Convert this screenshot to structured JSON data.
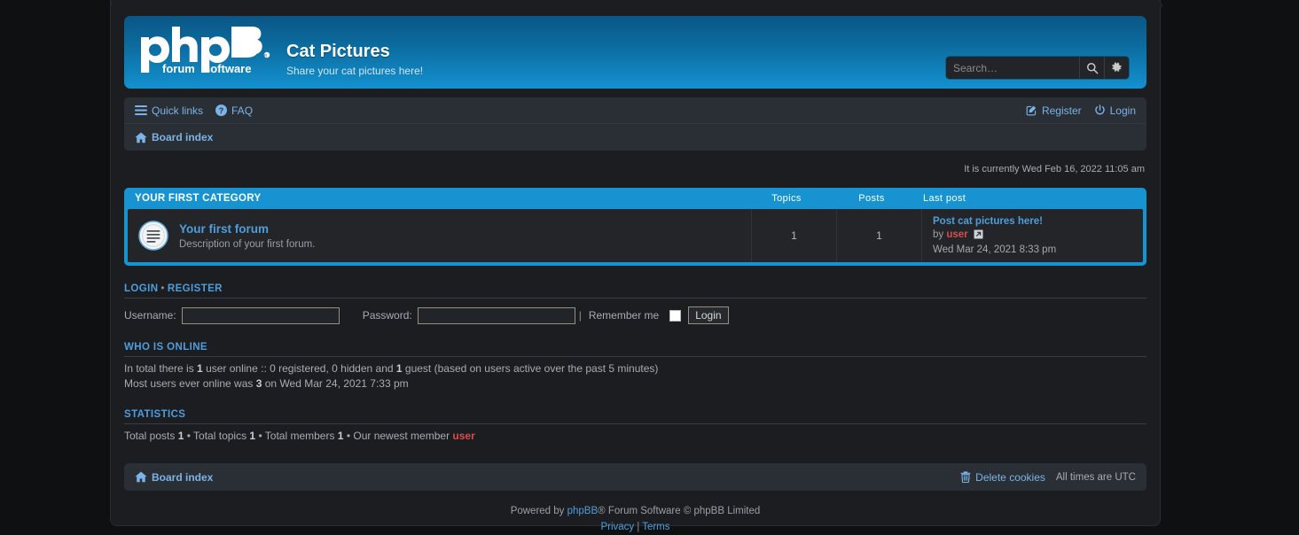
{
  "site": {
    "logo_text": "phpBB",
    "logo_sub_left": "forum",
    "logo_sub_right": "software",
    "title": "Cat Pictures",
    "description": "Share your cat pictures here!"
  },
  "search": {
    "placeholder": "Search…",
    "value": "",
    "search_icon": "search-icon",
    "options_icon": "gear-icon"
  },
  "nav": {
    "quick_links": "Quick links",
    "faq": "FAQ",
    "register": "Register",
    "login": "Login",
    "board_index": "Board index"
  },
  "current_time": "It is currently Wed Feb 16, 2022 11:05 am",
  "forum_table": {
    "category": "Your first category",
    "columns": {
      "topics": "Topics",
      "posts": "Posts",
      "last_post": "Last post"
    },
    "rows": [
      {
        "name": "Your first forum",
        "description": "Description of your first forum.",
        "topics": "1",
        "posts": "1",
        "last_post_title": "Post cat pictures here!",
        "last_post_by_label": "by",
        "last_post_author": "user",
        "last_post_date": "Wed Mar 24, 2021 8:33 pm"
      }
    ]
  },
  "login_section": {
    "title_login": "Login",
    "title_register": "Register",
    "separator": "•",
    "username_label": "Username:",
    "username_value": "",
    "password_label": "Password:",
    "password_value": "",
    "pipe": "|",
    "remember_label": "Remember me",
    "login_button": "Login"
  },
  "who_is_online": {
    "title": "Who is online",
    "line1_a": "In total there is ",
    "line1_total": "1",
    "line1_b": " user online :: 0 registered, 0 hidden and ",
    "line1_guests": "1",
    "line1_c": " guest (based on users active over the past 5 minutes)",
    "line2_a": "Most users ever online was ",
    "line2_peak": "3",
    "line2_b": " on Wed Mar 24, 2021 7:33 pm"
  },
  "statistics": {
    "title": "Statistics",
    "posts_label": "Total posts ",
    "posts_value": "1",
    "sep1": " • ",
    "topics_label": "Total topics ",
    "topics_value": "1",
    "sep2": " • ",
    "members_label": "Total members ",
    "members_value": "1",
    "sep3": " • ",
    "newest_label": "Our newest member ",
    "newest_member": "user"
  },
  "footer": {
    "board_index": "Board index",
    "delete_cookies": "Delete cookies",
    "timezone": "All times are UTC",
    "powered_pre": "Powered by ",
    "powered_brand": "phpBB",
    "powered_post": "® Forum Software © phpBB Limited",
    "privacy": "Privacy",
    "pipe": "|",
    "terms": "Terms"
  },
  "colors": {
    "accent": "#1793d1",
    "link": "#4e9ede",
    "admin": "#d84c4c",
    "page_bg": "#1b1d21",
    "nav_bg": "#2a2e35"
  }
}
